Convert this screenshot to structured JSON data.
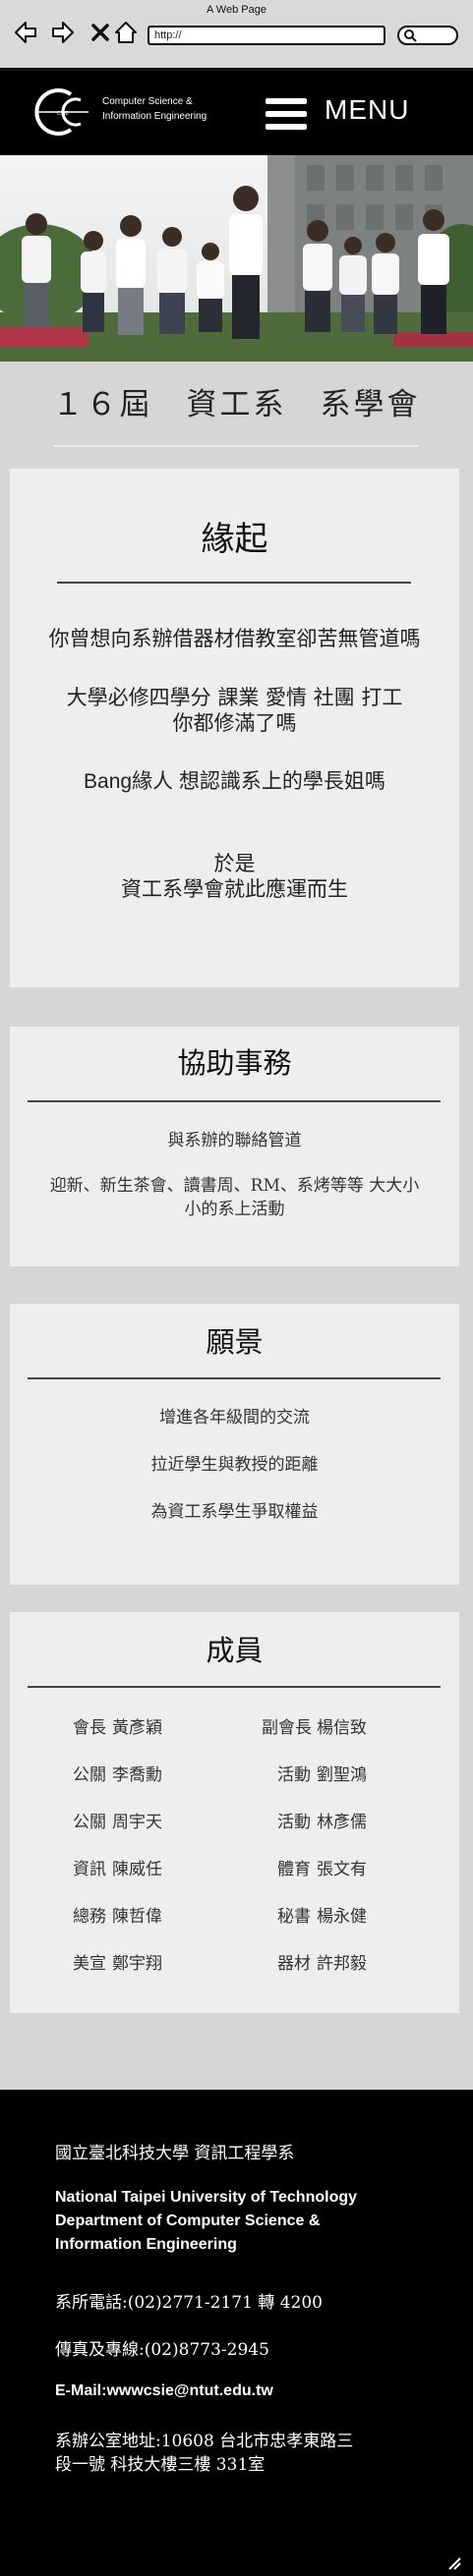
{
  "browser": {
    "title": "A Web Page",
    "url": "http://"
  },
  "header": {
    "logo_text_line1": "Computer Science &",
    "logo_text_line2": "Information Engineering",
    "menu_label": "MENU"
  },
  "club_title": "１６屆　資工系　系學會",
  "origin": {
    "heading": "緣起",
    "line1": "你曾想向系辦借器材借教室卻苦無管道嗎",
    "line2": "大學必修四學分 課業 愛情 社團 打工",
    "line3": "你都修滿了嗎",
    "line4": "Bang緣人 想認識系上的學長姐嗎",
    "line5": "於是",
    "line6": "資工系學會就此應運而生"
  },
  "services": {
    "heading": "協助事務",
    "line1": "與系辦的聯絡管道",
    "line2": "迎新、新生茶會、讀書周、RM、系烤等等 大大小",
    "line3": "小的系上活動"
  },
  "vision": {
    "heading": "願景",
    "line1": "增進各年級間的交流",
    "line2": "拉近學生與教授的距離",
    "line3": "為資工系學生爭取權益"
  },
  "members": {
    "heading": "成員",
    "left": [
      {
        "role": "會長",
        "name": "黃彥穎"
      },
      {
        "role": "公關",
        "name": "李喬勳"
      },
      {
        "role": "公關",
        "name": "周宇天"
      },
      {
        "role": "資訊",
        "name": "陳威任"
      },
      {
        "role": "總務",
        "name": "陳哲偉"
      },
      {
        "role": "美宣",
        "name": "鄭宇翔"
      }
    ],
    "right": [
      {
        "role": "副會長",
        "name": "楊信致"
      },
      {
        "role": "活動",
        "name": "劉聖鴻"
      },
      {
        "role": "活動",
        "name": "林彥儒"
      },
      {
        "role": "體育",
        "name": "張文有"
      },
      {
        "role": "秘書",
        "name": "楊永健"
      },
      {
        "role": "器材",
        "name": "許邦毅"
      }
    ]
  },
  "footer": {
    "school_zh": "國立臺北科技大學 資訊工程學系",
    "school_en_1": "National Taipei University of Technology",
    "school_en_2": "Department of Computer Science &",
    "school_en_3": "Information Engineering",
    "phone": "系所電話:(02)2771-2171 轉 4200",
    "fax": "傳真及專線:(02)8773-2945",
    "email": "E-Mail:wwwcsie@ntut.edu.tw",
    "address_1": "系辦公室地址:10608 台北市忠孝東路三",
    "address_2": "段一號 科技大樓三樓 331室"
  },
  "colors": {
    "page_bg": "#d6d6d6",
    "card_bg": "#eeeeee",
    "header_bg": "#000000"
  }
}
